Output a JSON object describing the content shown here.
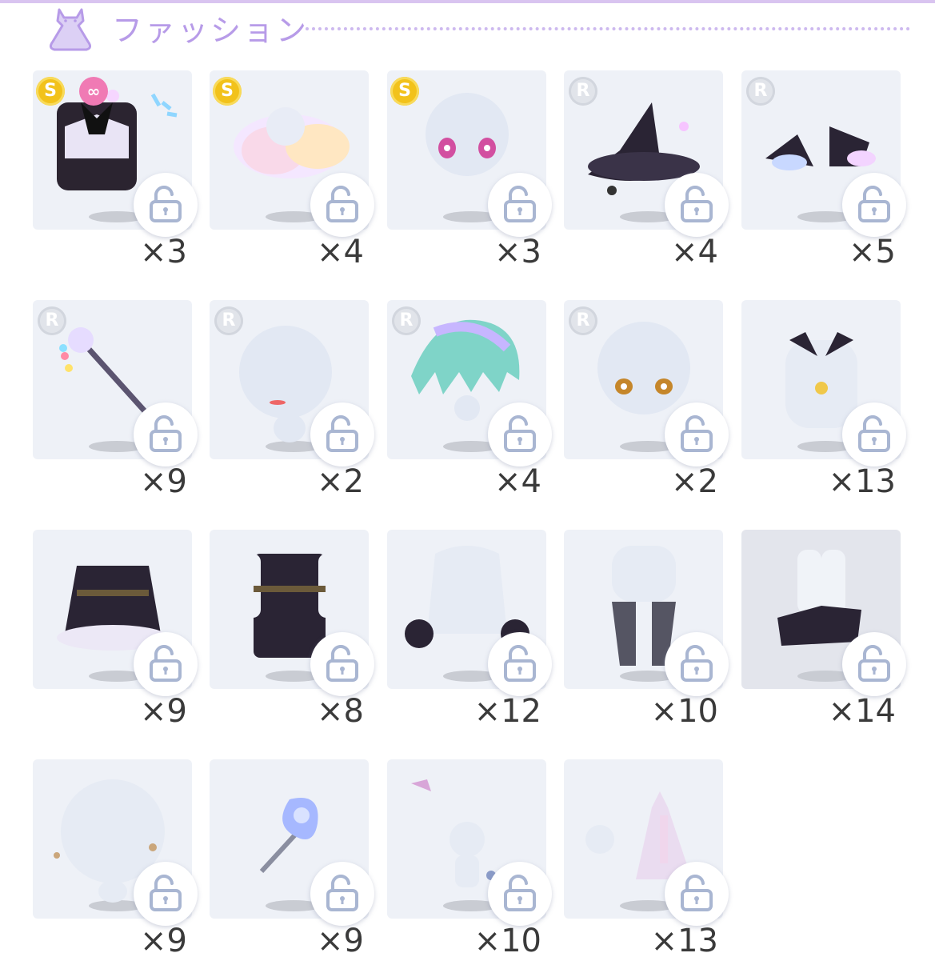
{
  "header": {
    "title": "ファッション",
    "icon": "dress-icon"
  },
  "items": [
    {
      "rarity": "S",
      "special": true,
      "count": "×3"
    },
    {
      "rarity": "S",
      "special": false,
      "count": "×4"
    },
    {
      "rarity": "S",
      "special": false,
      "count": "×3"
    },
    {
      "rarity": "R",
      "special": false,
      "count": "×4"
    },
    {
      "rarity": "R",
      "special": false,
      "count": "×5"
    },
    {
      "rarity": "R",
      "special": false,
      "count": "×9"
    },
    {
      "rarity": "R",
      "special": false,
      "count": "×2"
    },
    {
      "rarity": "R",
      "special": false,
      "count": "×4"
    },
    {
      "rarity": "R",
      "special": false,
      "count": "×2"
    },
    {
      "rarity": "",
      "special": false,
      "count": "×13"
    },
    {
      "rarity": "",
      "special": false,
      "count": "×9"
    },
    {
      "rarity": "",
      "special": false,
      "count": "×8"
    },
    {
      "rarity": "",
      "special": false,
      "count": "×12"
    },
    {
      "rarity": "",
      "special": false,
      "count": "×10"
    },
    {
      "rarity": "",
      "special": false,
      "count": "×14"
    },
    {
      "rarity": "",
      "special": false,
      "count": "×9"
    },
    {
      "rarity": "",
      "special": false,
      "count": "×9"
    },
    {
      "rarity": "",
      "special": false,
      "count": "×10"
    },
    {
      "rarity": "",
      "special": false,
      "count": "×13"
    }
  ],
  "badges": {
    "s_label": "S",
    "r_label": "R",
    "special_label": "∞"
  },
  "colors": {
    "accent": "#b79be8",
    "card_bg": "#eef1f7",
    "s_badge": "#f2c21b",
    "special_badge": "#f07ab4"
  }
}
